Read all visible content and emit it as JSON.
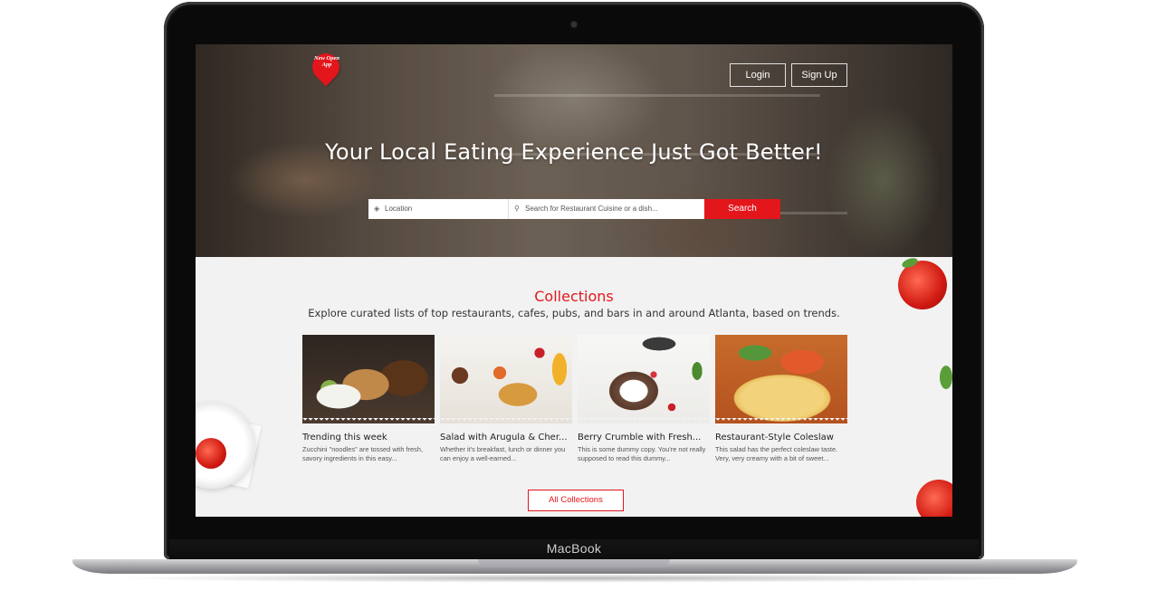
{
  "device": {
    "brand_label": "MacBook"
  },
  "header": {
    "logo_text": "New Open App",
    "login_label": "Login",
    "signup_label": "Sign Up"
  },
  "hero": {
    "title": "Your Local Eating Experience Just Got Better!",
    "location_placeholder": "Location",
    "search_placeholder": "Search for Restaurant Cuisine or a dish...",
    "search_button": "Search"
  },
  "collections": {
    "title": "Collections",
    "subtitle": "Explore curated lists of top restaurants, cafes, pubs, and bars in and around Atlanta, based on trends.",
    "cards": [
      {
        "title": "Trending this week",
        "desc": "Zucchini \"noodles\" are tossed with fresh, savory ingredients in this easy..."
      },
      {
        "title": "Salad with Arugula & Cher...",
        "desc": "Whether it's breakfast, lunch or dinner you can enjoy a well-earned..."
      },
      {
        "title": "Berry Crumble with Fresh...",
        "desc": "This is some dummy copy. You're not really supposed to read this dummy..."
      },
      {
        "title": "Restaurant-Style Coleslaw",
        "desc": "This salad has the perfect coleslaw taste. Very, very creamy with a bit of sweet..."
      }
    ],
    "all_button": "All Collections"
  },
  "colors": {
    "accent": "#e3161c",
    "background": "#f2f2f2"
  },
  "icons": {
    "location": "compass-icon",
    "search": "map-pin-icon"
  }
}
